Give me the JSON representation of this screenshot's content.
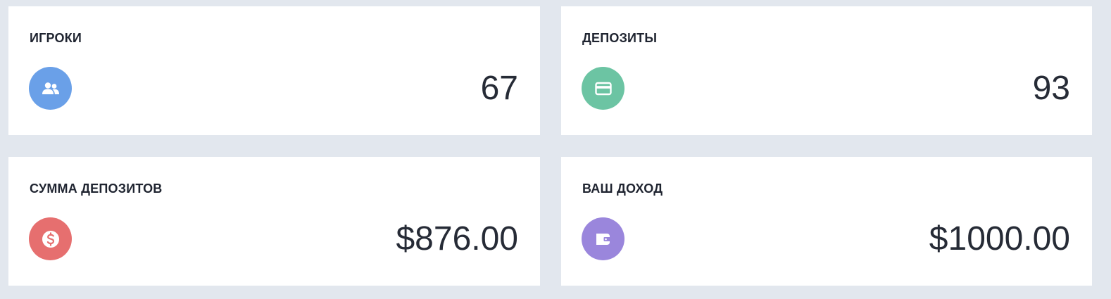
{
  "stats": [
    {
      "title": "ИГРОКИ",
      "value": "67",
      "icon": "users-icon",
      "color": "#6aa0e8"
    },
    {
      "title": "ДЕПОЗИТЫ",
      "value": "93",
      "icon": "credit-card-icon",
      "color": "#6cc4a3"
    },
    {
      "title": "СУММА ДЕПОЗИТОВ",
      "value": "$876.00",
      "icon": "dollar-coin-icon",
      "color": "#e66f6f"
    },
    {
      "title": "ВАШ ДОХОД",
      "value": "$1000.00",
      "icon": "wallet-icon",
      "color": "#9a86dc"
    }
  ]
}
